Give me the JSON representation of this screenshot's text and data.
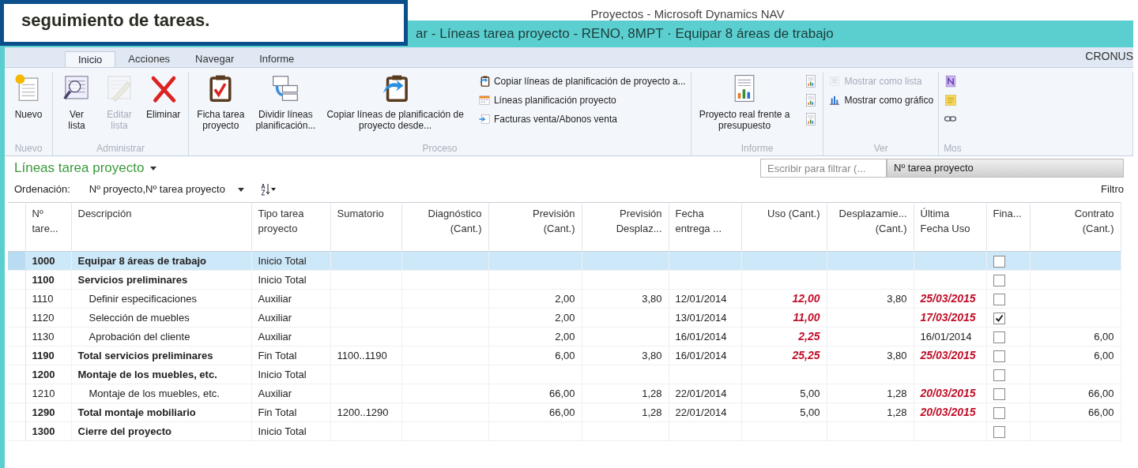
{
  "callout": {
    "text": "seguimiento de tareas."
  },
  "window": {
    "title": "Proyectos - Microsoft Dynamics NAV",
    "page_title": "ar - Líneas tarea proyecto - RENO, 8MPT · Equipar 8 áreas de trabajo",
    "company": "CRONUS"
  },
  "tabs": [
    {
      "label": "Inicio",
      "selected": true
    },
    {
      "label": "Acciones",
      "selected": false
    },
    {
      "label": "Navegar",
      "selected": false
    },
    {
      "label": "Informe",
      "selected": false
    }
  ],
  "ribbon": [
    {
      "label": "Nuevo",
      "large": [
        {
          "kind": "new",
          "lines": [
            "Nuevo"
          ],
          "disabled": false
        }
      ]
    },
    {
      "label": "Administrar",
      "large": [
        {
          "kind": "view",
          "lines": [
            "Ver",
            "lista"
          ],
          "disabled": false
        },
        {
          "kind": "edit",
          "lines": [
            "Editar",
            "lista"
          ],
          "disabled": true
        },
        {
          "kind": "delete",
          "lines": [
            "Eliminar"
          ],
          "disabled": false
        }
      ]
    },
    {
      "label": "Proceso",
      "large": [
        {
          "kind": "card",
          "lines": [
            "Ficha tarea",
            "proyecto"
          ],
          "disabled": false
        },
        {
          "kind": "split",
          "lines": [
            "Dividir líneas",
            "planificación..."
          ],
          "disabled": false
        },
        {
          "kind": "copy",
          "lines": [
            "Copiar líneas de planificación de",
            "proyecto desde..."
          ],
          "disabled": false
        }
      ],
      "small": [
        {
          "kind": "copy",
          "label": "Copiar líneas de planificación de proyecto a...",
          "disabled": false
        },
        {
          "kind": "calendar",
          "label": "Líneas planificación proyecto",
          "disabled": false
        },
        {
          "kind": "invoice",
          "label": "Facturas venta/Abonos venta",
          "disabled": false
        }
      ]
    },
    {
      "label": "Informe",
      "large": [
        {
          "kind": "report",
          "lines": [
            "Proyecto real frente a",
            "presupuesto"
          ],
          "disabled": false
        }
      ],
      "small": [
        {
          "kind": "report",
          "disabled": false
        },
        {
          "kind": "report",
          "disabled": false
        },
        {
          "kind": "report",
          "disabled": false
        }
      ]
    },
    {
      "label": "Ver",
      "small": [
        {
          "kind": "list",
          "label": "Mostrar como lista",
          "disabled": true
        },
        {
          "kind": "chart",
          "label": "Mostrar como gráfico",
          "disabled": false
        }
      ]
    },
    {
      "label": "Mos",
      "small": [
        {
          "kind": "note",
          "disabled": false
        },
        {
          "kind": "memo",
          "disabled": false
        },
        {
          "kind": "link",
          "disabled": false
        }
      ]
    }
  ],
  "list": {
    "title": "Líneas tarea proyecto",
    "sort_label": "Ordenación:",
    "sort_value": "Nº proyecto,Nº tarea proyecto",
    "filter_placeholder": "Escribir para filtrar (...",
    "filter_field": "Nº tarea proyecto",
    "filter_link": "Filtro"
  },
  "columns": [
    {
      "kind": "text",
      "lines": [
        "Nº",
        "tare..."
      ]
    },
    {
      "kind": "text",
      "lines": [
        "Descripción"
      ]
    },
    {
      "kind": "text",
      "lines": [
        "Tipo tarea",
        "proyecto"
      ]
    },
    {
      "kind": "text",
      "lines": [
        "Sumatorio"
      ]
    },
    {
      "kind": "number",
      "lines": [
        "Diagnóstico",
        "(Cant.)"
      ]
    },
    {
      "kind": "number",
      "lines": [
        "Previsión",
        "(Cant.)"
      ]
    },
    {
      "kind": "number",
      "lines": [
        "Previsión",
        "Desplaz..."
      ]
    },
    {
      "kind": "text",
      "lines": [
        "Fecha",
        "entrega ..."
      ]
    },
    {
      "kind": "number",
      "lines": [
        "Uso (Cant.)"
      ]
    },
    {
      "kind": "number",
      "lines": [
        "Desplazamie...",
        "(Cant.)"
      ]
    },
    {
      "kind": "text",
      "lines": [
        "Última",
        "Fecha Uso"
      ]
    },
    {
      "kind": "check",
      "lines": [
        "Fina..."
      ]
    },
    {
      "kind": "number",
      "lines": [
        "Contrato",
        "(Cant.)"
      ]
    }
  ],
  "rows": [
    {
      "no": "1000",
      "description": "Equipar 8 áreas de trabajo",
      "type": "Inicio Total",
      "bold": true,
      "selected": true,
      "finished": false,
      "children": [
        {
          "no": "1100",
          "description": "Servicios preliminares",
          "type": "Inicio Total",
          "bold": true,
          "selected": false,
          "finished": false,
          "children": [
            {
              "no": "1110",
              "description": "Definir especificaciones",
              "type": "Auxiliar",
              "bold": false,
              "selected": false,
              "prevision": "2,00",
              "prevision_desplaz": "3,80",
              "fecha_entrega": "12/01/2014",
              "uso": "12,00",
              "uso_alert": true,
              "desplazamiento": "3,80",
              "ultima_fecha": "25/03/2015",
              "ultima_alert": true,
              "finished": false
            },
            {
              "no": "1120",
              "description": "Selección de muebles",
              "type": "Auxiliar",
              "bold": false,
              "selected": false,
              "prevision": "2,00",
              "fecha_entrega": "13/01/2014",
              "uso": "11,00",
              "uso_alert": true,
              "ultima_fecha": "17/03/2015",
              "ultima_alert": true,
              "finished": true
            },
            {
              "no": "1130",
              "description": "Aprobación del cliente",
              "type": "Auxiliar",
              "bold": false,
              "selected": false,
              "prevision": "2,00",
              "fecha_entrega": "16/01/2014",
              "uso": "2,25",
              "uso_alert": true,
              "ultima_fecha": "16/01/2014",
              "ultima_alert": false,
              "finished": false,
              "contrato": "6,00"
            }
          ]
        },
        {
          "no": "1190",
          "description": "Total servicios preliminares",
          "type": "Fin Total",
          "sumatorio": "1100..1190",
          "bold": true,
          "selected": false,
          "prevision": "6,00",
          "prevision_desplaz": "3,80",
          "fecha_entrega": "16/01/2014",
          "uso": "25,25",
          "uso_alert": true,
          "desplazamiento": "3,80",
          "ultima_fecha": "25/03/2015",
          "ultima_alert": true,
          "finished": false,
          "contrato": "6,00"
        },
        {
          "no": "1200",
          "description": "Montaje de los muebles, etc.",
          "type": "Inicio Total",
          "bold": true,
          "selected": false,
          "finished": false,
          "children": [
            {
              "no": "1210",
              "description": "Montaje de los muebles, etc.",
              "type": "Auxiliar",
              "bold": false,
              "selected": false,
              "prevision": "66,00",
              "prevision_desplaz": "1,28",
              "fecha_entrega": "22/01/2014",
              "uso": "5,00",
              "uso_alert": false,
              "desplazamiento": "1,28",
              "ultima_fecha": "20/03/2015",
              "ultima_alert": true,
              "finished": false,
              "contrato": "66,00"
            }
          ]
        },
        {
          "no": "1290",
          "description": "Total montaje mobiliario",
          "type": "Fin Total",
          "sumatorio": "1200..1290",
          "bold": true,
          "selected": false,
          "prevision": "66,00",
          "prevision_desplaz": "1,28",
          "fecha_entrega": "22/01/2014",
          "uso": "5,00",
          "uso_alert": false,
          "desplazamiento": "1,28",
          "ultima_fecha": "20/03/2015",
          "ultima_alert": true,
          "finished": false,
          "contrato": "66,00"
        },
        {
          "no": "1300",
          "description": "Cierre del proyecto",
          "type": "Inicio Total",
          "bold": true,
          "selected": false,
          "finished": false
        }
      ]
    }
  ]
}
